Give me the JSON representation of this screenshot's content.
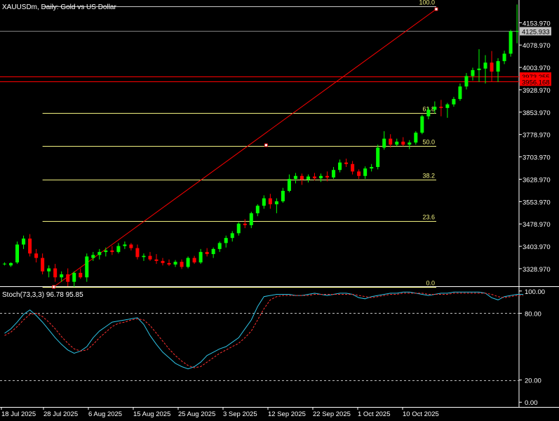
{
  "window": {
    "symbol_label": "XAUUSDm, Daily:  Gold vs US Dollar"
  },
  "colors": {
    "background": "#000000",
    "bull": "#00ff00",
    "bear": "#ff0000",
    "fib": "#f0f080",
    "trendline": "#ff0000",
    "stoch_main": "#2ec4e6",
    "stoch_signal": "#ff3030",
    "axis_text": "#ffffff",
    "price_line": "#808080"
  },
  "chart_data": [
    {
      "type": "candlestick",
      "title": "XAUUSDm, Daily:  Gold vs US Dollar",
      "ylim": [
        3270,
        4230
      ],
      "y_ticks": [
        "4153.970",
        "4078.970",
        "4003.970",
        "3928.970",
        "3853.970",
        "3778.970",
        "3703.970",
        "3628.970",
        "3553.970",
        "3478.970",
        "3403.970",
        "3328.970"
      ],
      "x_ticks": [
        "18 Jul 2025",
        "28 Jul 2025",
        "6 Aug 2025",
        "15 Aug 2025",
        "25 Aug 2025",
        "3 Sep 2025",
        "12 Sep 2025",
        "22 Sep 2025",
        "1 Oct 2025",
        "10 Oct 2025"
      ],
      "current_price": "4125.933",
      "price_tags": [
        "3973.255",
        "3956.168"
      ],
      "price_tag_values": [
        3973.255,
        3956.168
      ],
      "fibonacci": {
        "levels": [
          {
            "label": "100.0",
            "price": 4210
          },
          {
            "label": "61.8",
            "price": 3852
          },
          {
            "label": "50.0",
            "price": 3740
          },
          {
            "label": "38.2",
            "price": 3628
          },
          {
            "label": "23.6",
            "price": 3490
          },
          {
            "label": "0.0",
            "price": 3268
          }
        ]
      },
      "trendline": {
        "from_bar": 8,
        "from_price": 3268,
        "to_bar": 88,
        "to_price": 4210
      },
      "candles": [
        {
          "o": 3345,
          "h": 3350,
          "l": 3340,
          "c": 3346
        },
        {
          "o": 3340,
          "h": 3350,
          "l": 3335,
          "c": 3348
        },
        {
          "o": 3350,
          "h": 3420,
          "l": 3345,
          "c": 3410
        },
        {
          "o": 3410,
          "h": 3440,
          "l": 3395,
          "c": 3430
        },
        {
          "o": 3430,
          "h": 3445,
          "l": 3370,
          "c": 3380
        },
        {
          "o": 3380,
          "h": 3395,
          "l": 3350,
          "c": 3365
        },
        {
          "o": 3365,
          "h": 3380,
          "l": 3310,
          "c": 3320
        },
        {
          "o": 3320,
          "h": 3340,
          "l": 3300,
          "c": 3330
        },
        {
          "o": 3330,
          "h": 3345,
          "l": 3285,
          "c": 3300
        },
        {
          "o": 3300,
          "h": 3320,
          "l": 3285,
          "c": 3310
        },
        {
          "o": 3310,
          "h": 3330,
          "l": 3270,
          "c": 3285
        },
        {
          "o": 3285,
          "h": 3320,
          "l": 3268,
          "c": 3315
        },
        {
          "o": 3315,
          "h": 3330,
          "l": 3295,
          "c": 3300
        },
        {
          "o": 3300,
          "h": 3380,
          "l": 3285,
          "c": 3370
        },
        {
          "o": 3365,
          "h": 3385,
          "l": 3355,
          "c": 3375
        },
        {
          "o": 3375,
          "h": 3395,
          "l": 3360,
          "c": 3385
        },
        {
          "o": 3385,
          "h": 3400,
          "l": 3370,
          "c": 3390
        },
        {
          "o": 3390,
          "h": 3405,
          "l": 3375,
          "c": 3385
        },
        {
          "o": 3385,
          "h": 3415,
          "l": 3380,
          "c": 3405
        },
        {
          "o": 3405,
          "h": 3420,
          "l": 3395,
          "c": 3410
        },
        {
          "o": 3410,
          "h": 3415,
          "l": 3390,
          "c": 3398
        },
        {
          "o": 3398,
          "h": 3410,
          "l": 3360,
          "c": 3368
        },
        {
          "o": 3368,
          "h": 3380,
          "l": 3355,
          "c": 3372
        },
        {
          "o": 3372,
          "h": 3385,
          "l": 3355,
          "c": 3360
        },
        {
          "o": 3360,
          "h": 3378,
          "l": 3345,
          "c": 3355
        },
        {
          "o": 3355,
          "h": 3365,
          "l": 3340,
          "c": 3348
        },
        {
          "o": 3348,
          "h": 3360,
          "l": 3338,
          "c": 3343
        },
        {
          "o": 3343,
          "h": 3358,
          "l": 3335,
          "c": 3352
        },
        {
          "o": 3352,
          "h": 3360,
          "l": 3328,
          "c": 3335
        },
        {
          "o": 3335,
          "h": 3370,
          "l": 3330,
          "c": 3365
        },
        {
          "o": 3365,
          "h": 3372,
          "l": 3345,
          "c": 3350
        },
        {
          "o": 3350,
          "h": 3395,
          "l": 3345,
          "c": 3385
        },
        {
          "o": 3385,
          "h": 3398,
          "l": 3370,
          "c": 3378
        },
        {
          "o": 3378,
          "h": 3400,
          "l": 3365,
          "c": 3395
        },
        {
          "o": 3395,
          "h": 3420,
          "l": 3385,
          "c": 3415
        },
        {
          "o": 3415,
          "h": 3440,
          "l": 3400,
          "c": 3432
        },
        {
          "o": 3432,
          "h": 3455,
          "l": 3420,
          "c": 3448
        },
        {
          "o": 3448,
          "h": 3485,
          "l": 3440,
          "c": 3480
        },
        {
          "o": 3480,
          "h": 3495,
          "l": 3465,
          "c": 3475
        },
        {
          "o": 3475,
          "h": 3520,
          "l": 3465,
          "c": 3515
        },
        {
          "o": 3515,
          "h": 3545,
          "l": 3505,
          "c": 3540
        },
        {
          "o": 3540,
          "h": 3575,
          "l": 3530,
          "c": 3565
        },
        {
          "o": 3565,
          "h": 3580,
          "l": 3530,
          "c": 3545
        },
        {
          "o": 3545,
          "h": 3565,
          "l": 3515,
          "c": 3555
        },
        {
          "o": 3555,
          "h": 3600,
          "l": 3550,
          "c": 3590
        },
        {
          "o": 3590,
          "h": 3645,
          "l": 3585,
          "c": 3630
        },
        {
          "o": 3630,
          "h": 3650,
          "l": 3615,
          "c": 3640
        },
        {
          "o": 3640,
          "h": 3648,
          "l": 3610,
          "c": 3628
        },
        {
          "o": 3628,
          "h": 3645,
          "l": 3618,
          "c": 3638
        },
        {
          "o": 3638,
          "h": 3650,
          "l": 3625,
          "c": 3632
        },
        {
          "o": 3632,
          "h": 3648,
          "l": 3620,
          "c": 3640
        },
        {
          "o": 3640,
          "h": 3655,
          "l": 3622,
          "c": 3635
        },
        {
          "o": 3635,
          "h": 3670,
          "l": 3630,
          "c": 3660
        },
        {
          "o": 3660,
          "h": 3695,
          "l": 3652,
          "c": 3685
        },
        {
          "o": 3685,
          "h": 3698,
          "l": 3670,
          "c": 3680
        },
        {
          "o": 3680,
          "h": 3690,
          "l": 3645,
          "c": 3655
        },
        {
          "o": 3655,
          "h": 3662,
          "l": 3630,
          "c": 3640
        },
        {
          "o": 3640,
          "h": 3672,
          "l": 3630,
          "c": 3665
        },
        {
          "o": 3665,
          "h": 3680,
          "l": 3655,
          "c": 3670
        },
        {
          "o": 3670,
          "h": 3745,
          "l": 3662,
          "c": 3735
        },
        {
          "o": 3735,
          "h": 3790,
          "l": 3728,
          "c": 3765
        },
        {
          "o": 3765,
          "h": 3780,
          "l": 3735,
          "c": 3745
        },
        {
          "o": 3745,
          "h": 3765,
          "l": 3740,
          "c": 3755
        },
        {
          "o": 3755,
          "h": 3770,
          "l": 3740,
          "c": 3745
        },
        {
          "o": 3745,
          "h": 3760,
          "l": 3730,
          "c": 3752
        },
        {
          "o": 3752,
          "h": 3790,
          "l": 3745,
          "c": 3785
        },
        {
          "o": 3785,
          "h": 3845,
          "l": 3780,
          "c": 3840
        },
        {
          "o": 3840,
          "h": 3870,
          "l": 3830,
          "c": 3862
        },
        {
          "o": 3862,
          "h": 3890,
          "l": 3850,
          "c": 3872
        },
        {
          "o": 3872,
          "h": 3895,
          "l": 3840,
          "c": 3868
        },
        {
          "o": 3868,
          "h": 3885,
          "l": 3835,
          "c": 3880
        },
        {
          "o": 3880,
          "h": 3905,
          "l": 3872,
          "c": 3898
        },
        {
          "o": 3898,
          "h": 3950,
          "l": 3892,
          "c": 3940
        },
        {
          "o": 3940,
          "h": 3985,
          "l": 3930,
          "c": 3975
        },
        {
          "o": 3975,
          "h": 4003,
          "l": 3960,
          "c": 3995
        },
        {
          "o": 3995,
          "h": 4065,
          "l": 3955,
          "c": 4000
        },
        {
          "o": 4000,
          "h": 4045,
          "l": 3950,
          "c": 4020
        },
        {
          "o": 4020,
          "h": 4059,
          "l": 3957,
          "c": 3990
        },
        {
          "o": 3990,
          "h": 4035,
          "l": 3955,
          "c": 4025
        },
        {
          "o": 4025,
          "h": 4060,
          "l": 4015,
          "c": 4050
        },
        {
          "o": 4050,
          "h": 4130,
          "l": 4040,
          "c": 4125
        },
        {
          "o": 4125,
          "h": 4215,
          "l": 4085,
          "c": 4125.933
        }
      ]
    },
    {
      "type": "line",
      "title": "Stoch(73,3,3) 96.78 95.85",
      "ylim": [
        -3,
        103
      ],
      "y_ticks": [
        "100.00",
        "80.00",
        "20.00",
        "0.00"
      ],
      "levels": [
        80,
        20
      ],
      "series": [
        {
          "name": "main",
          "values": [
            62,
            66,
            72,
            79,
            83,
            78,
            72,
            65,
            58,
            52,
            47,
            44,
            46,
            50,
            58,
            64,
            68,
            72,
            73,
            74,
            75,
            76,
            70,
            60,
            52,
            45,
            40,
            35,
            32,
            30,
            32,
            36,
            42,
            45,
            48,
            50,
            54,
            58,
            66,
            74,
            86,
            95,
            96,
            97,
            97,
            97,
            96,
            96,
            97,
            98,
            97,
            96,
            97,
            98,
            98,
            97,
            94,
            93,
            95,
            96,
            97,
            98,
            98,
            99,
            99,
            98,
            97,
            96,
            97,
            98,
            98,
            99,
            99,
            99,
            99,
            99,
            98,
            94,
            92,
            95,
            96,
            97,
            97
          ]
        },
        {
          "name": "signal",
          "values": [
            60,
            63,
            68,
            74,
            79,
            80,
            77,
            72,
            66,
            59,
            53,
            48,
            46,
            47,
            52,
            58,
            63,
            68,
            71,
            72,
            74,
            75,
            74,
            69,
            62,
            55,
            48,
            42,
            37,
            33,
            31,
            32,
            36,
            40,
            44,
            47,
            50,
            53,
            58,
            64,
            74,
            84,
            92,
            95,
            96,
            96,
            96,
            96,
            96,
            97,
            97,
            97,
            97,
            97,
            97,
            97,
            96,
            95,
            94,
            95,
            96,
            97,
            97,
            98,
            98,
            98,
            98,
            97,
            97,
            97,
            97,
            98,
            98,
            98,
            98,
            98,
            98,
            97,
            95,
            94,
            95,
            96,
            96
          ]
        }
      ]
    }
  ]
}
